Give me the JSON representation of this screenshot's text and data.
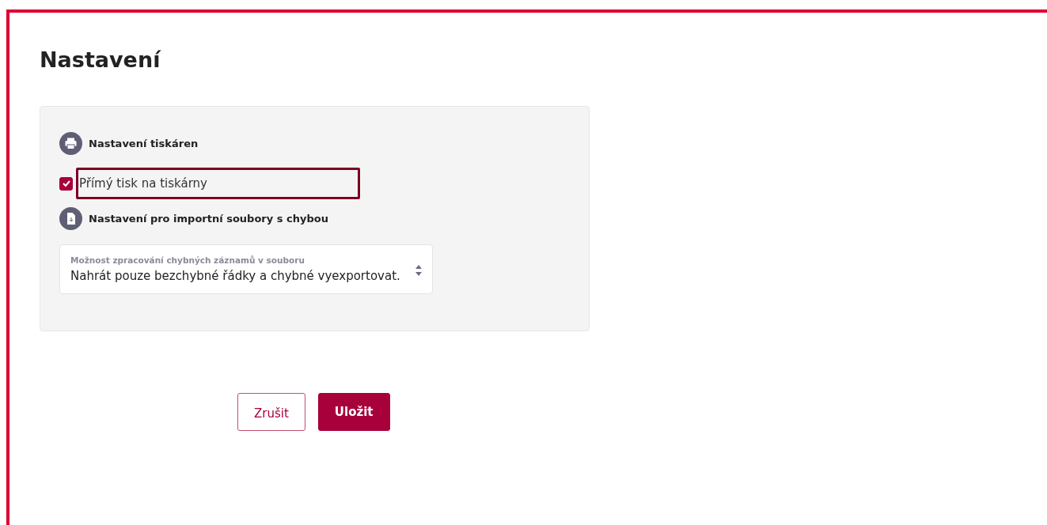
{
  "title": "Nastavení",
  "sections": [
    {
      "kind": "printer",
      "heading": "Nastavení tiskáren",
      "checkbox": {
        "label": "Přímý tisk na tiskárny",
        "checked": true,
        "focused": true
      }
    },
    {
      "kind": "file",
      "heading": "Nastavení pro importní soubory s chybou",
      "select": {
        "label": "Možnost zpracování chybných záznamů v souboru",
        "value": "Nahrát pouze bezchybné řádky a chybné vyexportovat."
      }
    }
  ],
  "buttons": [
    {
      "kind": "secondary",
      "label": "Zrušit"
    },
    {
      "kind": "primary",
      "label": "Uložit"
    }
  ]
}
